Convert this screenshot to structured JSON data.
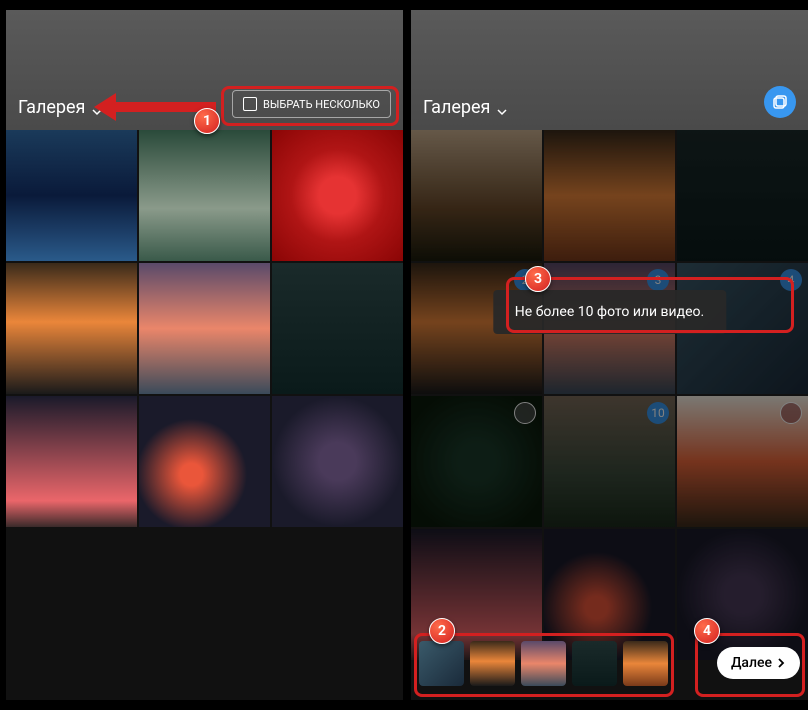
{
  "left": {
    "header": {
      "dropdown_label": "Галерея",
      "select_button_label": "ВЫБРАТЬ НЕСКОЛЬКО"
    }
  },
  "right": {
    "header": {
      "dropdown_label": "Галерея"
    },
    "badges": {
      "r1c1": "2",
      "r1c2": "3",
      "r1c3": "4",
      "r2c2": "10"
    },
    "toast_message": "Не более 10 фото или видео.",
    "next_button_label": "Далее"
  },
  "annotations": {
    "step1": "1",
    "step2": "2",
    "step3": "3",
    "step4": "4"
  }
}
